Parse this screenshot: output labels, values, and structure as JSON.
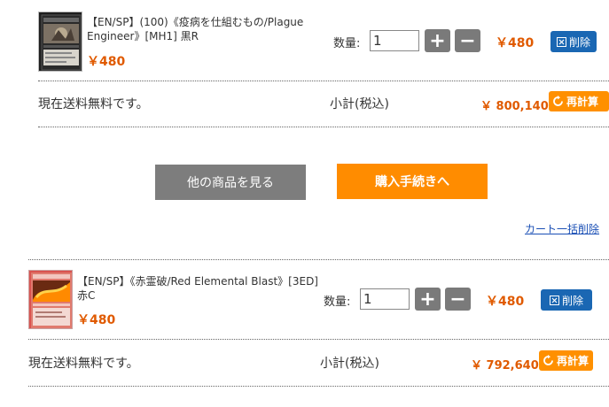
{
  "items": [
    {
      "name_line1": "【EN/SP】(100)《疫病を仕組むもの/Plague",
      "name_line2": "Engineer》[MH1] 黒R",
      "price": "￥480",
      "qty_label": "数量:",
      "qty_value": "1",
      "plus": "+",
      "minus": "−",
      "unit_price": "￥480",
      "delete_label": "削除",
      "shipping_text": "現在送料無料です。",
      "subtotal_label": "小計(税込)",
      "subtotal_value": "￥ 800,140",
      "recalc_label": "再計算"
    },
    {
      "name_line1": "【EN/SP】《赤霊破/Red Elemental Blast》[3ED]",
      "name_line2": "赤C",
      "price": "￥480",
      "qty_label": "数量:",
      "qty_value": "1",
      "plus": "+",
      "minus": "−",
      "unit_price": "￥480",
      "delete_label": "削除",
      "shipping_text": "現在送料無料です。",
      "subtotal_label": "小計(税込)",
      "subtotal_value": "￥ 792,640",
      "recalc_label": "再計算"
    }
  ],
  "actions": {
    "continue_label": "他の商品を見る",
    "checkout_label": "購入手続きへ",
    "clear_cart_label": "カート一括削除"
  },
  "colors": {
    "price": "#e05a00",
    "delete": "#1a67b3",
    "recalc": "#ff9000",
    "checkout": "#ff8c00",
    "continue": "#7d7d7d"
  }
}
